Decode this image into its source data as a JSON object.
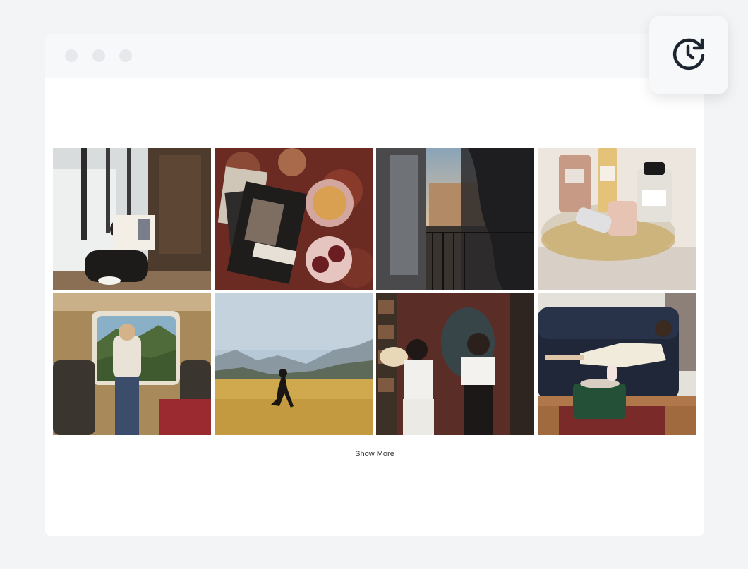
{
  "gallery": {
    "images": [
      {
        "name": "reading-by-window-photo"
      },
      {
        "name": "books-and-tea-on-rug-photo"
      },
      {
        "name": "balcony-sunset-photo"
      },
      {
        "name": "perfume-bottles-tray-photo"
      },
      {
        "name": "train-window-photo"
      },
      {
        "name": "running-in-field-photo"
      },
      {
        "name": "dancing-friends-photo"
      },
      {
        "name": "lounging-on-sofa-photo"
      }
    ],
    "show_more_label": "Show More"
  },
  "toolbar": {
    "history_icon": "clock-rotate-icon"
  }
}
